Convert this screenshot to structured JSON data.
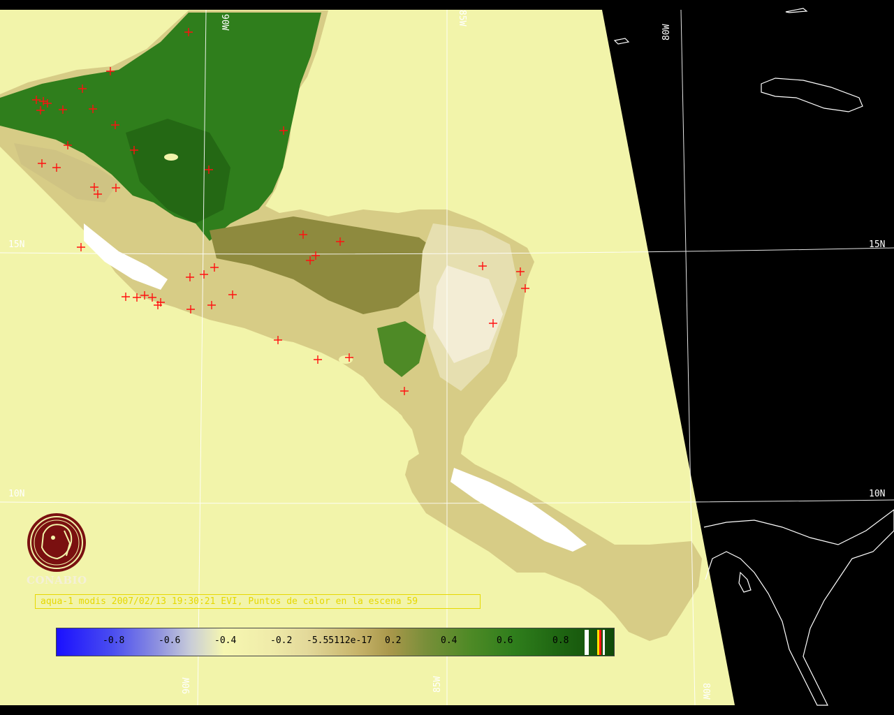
{
  "map": {
    "grid_labels": {
      "lon_top": [
        "90W",
        "85W",
        "80W"
      ],
      "lon_bottom": [
        "90W",
        "85W",
        "80W"
      ],
      "lat_left": [
        "15N",
        "10N"
      ],
      "lat_right": [
        "15N",
        "10N"
      ]
    },
    "colors": {
      "ocean": "#f2f4aa",
      "outside_scene": "#000000",
      "vegetation_dense": "#2a7a16",
      "vegetation_mid": "#8c8c3c",
      "land_low": "#d9cf8a",
      "cloud": "#ffffff",
      "hotspot": "#ff1010",
      "gridline": "#ffffff",
      "caption": "#e6d800"
    }
  },
  "logo": {
    "name": "CONABIO",
    "icon": "conabio-logo-icon"
  },
  "caption": "aqua-1 modis 2007/02/13 19:30:21 EVI, Puntos de calor en la escena 59",
  "colorbar": {
    "labels": [
      "-0.8",
      "-0.6",
      "-0.4",
      "-0.2",
      "-5.55112e-17",
      "0.2",
      "0.4",
      "0.6",
      "0.8"
    ]
  }
}
